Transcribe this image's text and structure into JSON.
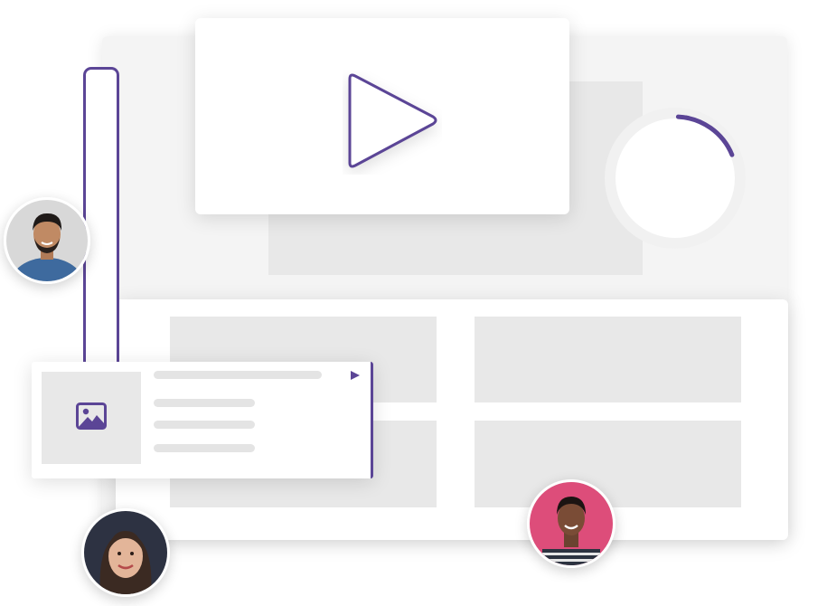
{
  "colors": {
    "accent": "#5b4596",
    "placeholder": "#e8e8e8",
    "card": "#ffffff",
    "avatar_bg_man": "#d8d8d8",
    "avatar_bg_woman_right": "#dd4d7a",
    "avatar_bg_woman_left": "#2d3242"
  },
  "icons": {
    "play": "play-icon",
    "image": "image-icon",
    "small_play": "small-play-icon"
  },
  "progress_ring": {
    "fraction": 0.18
  },
  "avatars": [
    {
      "name": "avatar-man",
      "icon": "person-avatar"
    },
    {
      "name": "avatar-woman-right",
      "icon": "person-avatar"
    },
    {
      "name": "avatar-woman-left",
      "icon": "person-avatar"
    }
  ]
}
